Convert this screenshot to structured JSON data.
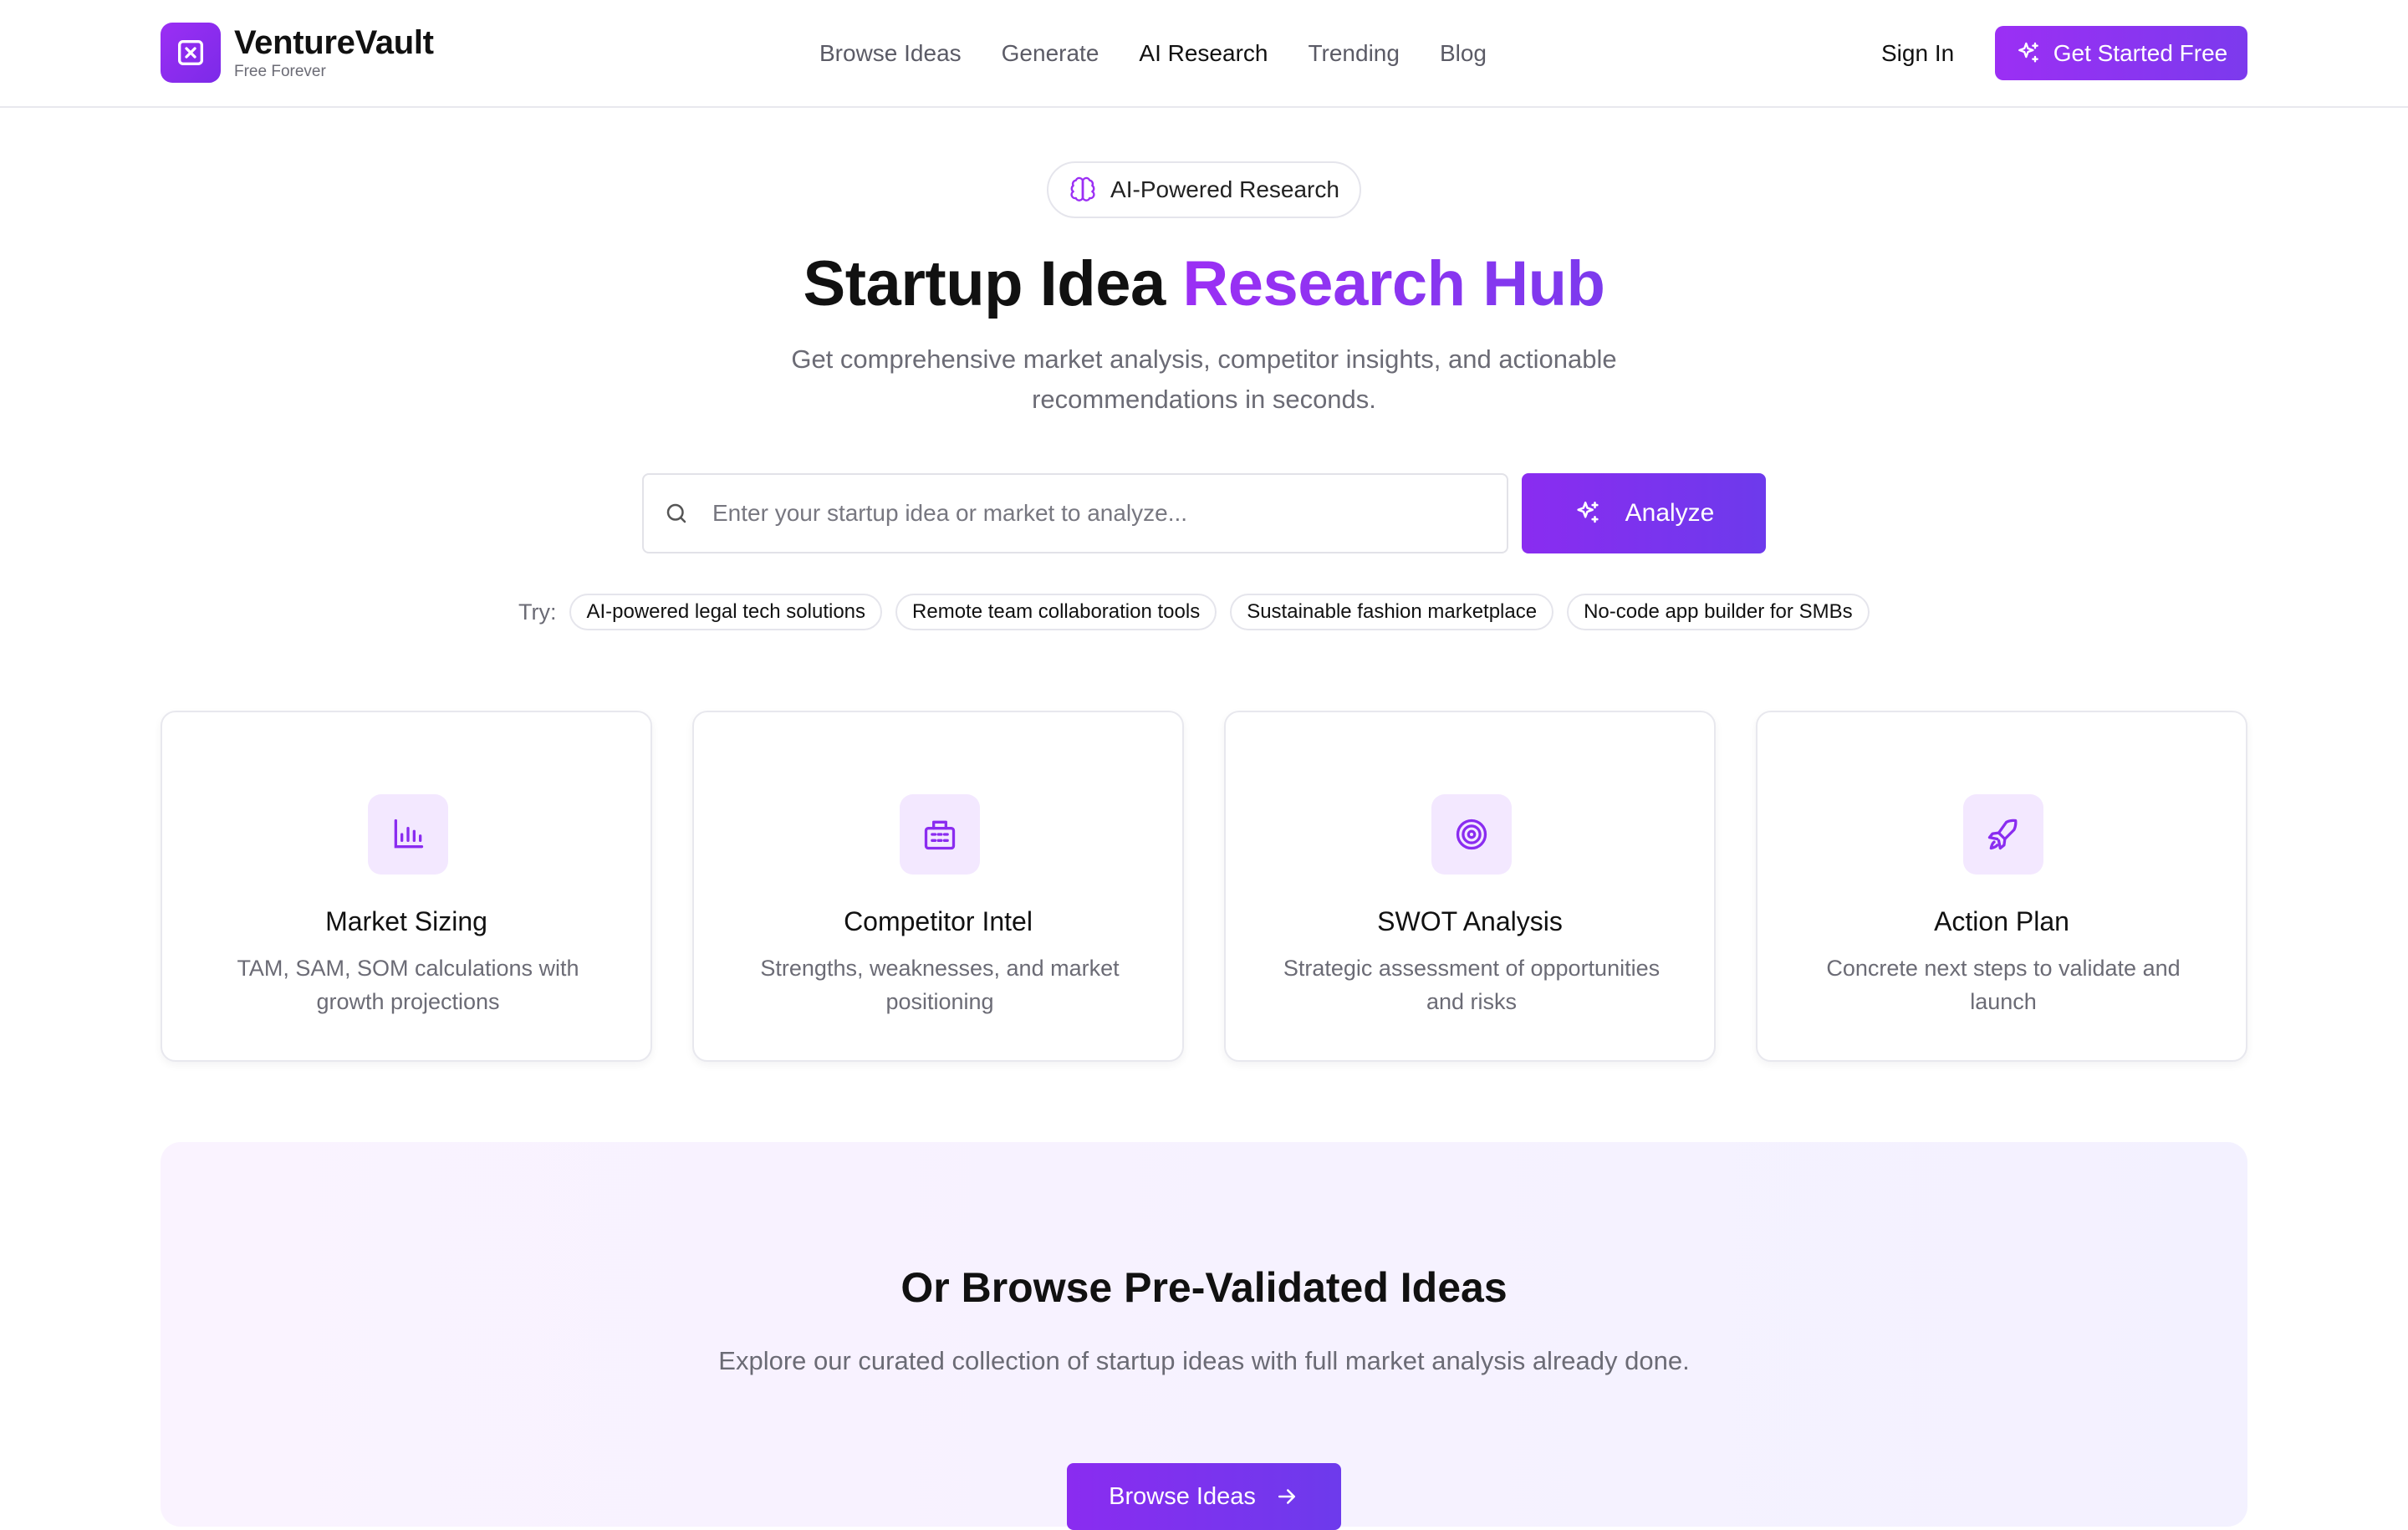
{
  "brand": {
    "name": "VentureVault",
    "tagline": "Free Forever",
    "accent_color": "#9b2ff4",
    "accent_color_2": "#7c3aed",
    "icon": "square-x-icon"
  },
  "nav": {
    "items": [
      {
        "label": "Browse Ideas",
        "active": false
      },
      {
        "label": "Generate",
        "active": false
      },
      {
        "label": "AI Research",
        "active": true
      },
      {
        "label": "Trending",
        "active": false
      },
      {
        "label": "Blog",
        "active": false
      }
    ],
    "sign_in": "Sign In",
    "cta": "Get Started Free",
    "cta_icon": "sparkles-icon"
  },
  "hero": {
    "badge": "AI-Powered Research",
    "badge_icon": "brain-icon",
    "title_plain": "Startup Idea",
    "title_accent": "Research Hub",
    "subtitle": "Get comprehensive market analysis, competitor insights, and actionable recommendations in seconds."
  },
  "search": {
    "placeholder": "Enter your startup idea or market to analyze...",
    "value": "",
    "button": "Analyze",
    "try_label": "Try:",
    "suggestions": [
      "AI-powered legal tech solutions",
      "Remote team collaboration tools",
      "Sustainable fashion marketplace",
      "No-code app builder for SMBs"
    ]
  },
  "features": [
    {
      "title": "Market Sizing",
      "desc": "TAM, SAM, SOM calculations with growth projections",
      "icon": "bar-chart-icon"
    },
    {
      "title": "Competitor Intel",
      "desc": "Strengths, weaknesses, and market positioning",
      "icon": "building-icon"
    },
    {
      "title": "SWOT Analysis",
      "desc": "Strategic assessment of opportunities and risks",
      "icon": "target-icon"
    },
    {
      "title": "Action Plan",
      "desc": "Concrete next steps to validate and launch",
      "icon": "rocket-icon"
    }
  ],
  "browse": {
    "title": "Or Browse Pre-Validated Ideas",
    "desc": "Explore our curated collection of startup ideas with full market analysis already done.",
    "button": "Browse Ideas",
    "button_icon": "arrow-right-icon"
  }
}
